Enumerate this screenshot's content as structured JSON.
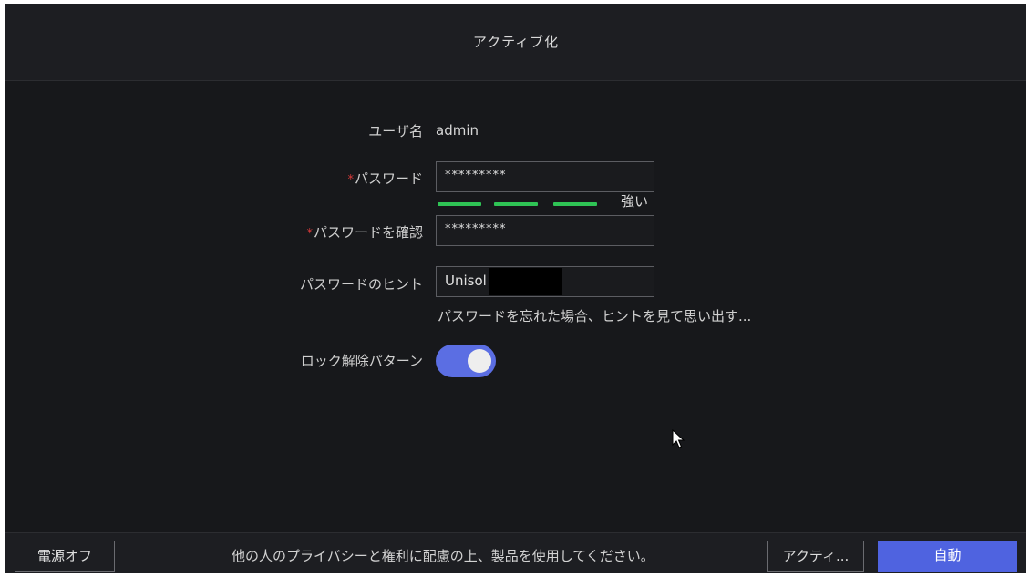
{
  "dialog": {
    "title": "アクティブ化"
  },
  "form": {
    "username_label": "ユーザ名",
    "username_value": "admin",
    "password_label": "パスワード",
    "password_value": "*********",
    "password_strength": {
      "label": "強い",
      "level": 3,
      "max_level": 3,
      "color": "#2fc455"
    },
    "confirm_label": "パスワードを確認",
    "confirm_value": "*********",
    "hint_label": "パスワードのヒント",
    "hint_value": "Unisol",
    "hint_note": "パスワードを忘れた場合、ヒントを見て思い出す...",
    "unlock_pattern_label": "ロック解除パターン",
    "unlock_pattern_enabled": true,
    "required_mark": "*"
  },
  "footer": {
    "power_off_label": "電源オフ",
    "privacy_note": "他の人のプライバシーと権利に配慮の上、製品を使用してください。",
    "activate_label": "アクティ...",
    "auto_label": "自動"
  },
  "colors": {
    "accent": "#4f63e0",
    "toggle_on": "#5b6ee3",
    "required": "#d93a3a",
    "strength_strong": "#2fc455",
    "background": "#17181b"
  },
  "icons": {
    "cursor": "mouse-pointer-icon"
  }
}
